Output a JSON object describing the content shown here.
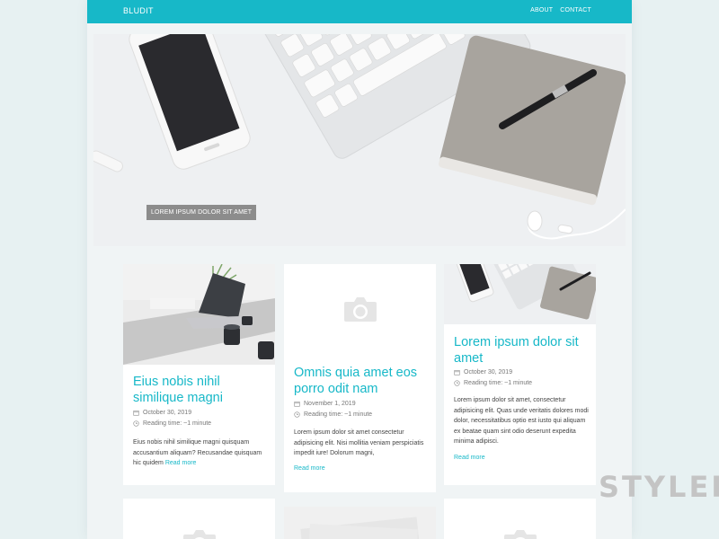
{
  "header": {
    "brand": "BLUDIT",
    "nav": [
      {
        "label": "ABOUT"
      },
      {
        "label": "CONTACT"
      }
    ]
  },
  "hero": {
    "caption": "LOREM IPSUM DOLOR SIT AMET"
  },
  "posts": [
    {
      "title": "Eius nobis nihil similique magni",
      "date": "October 30, 2019",
      "reading": "Reading time: ~1 minute",
      "excerpt": "Eius nobis nihil similique magni quisquam accusantium aliquam? Recusandae quisquam hic quidem",
      "read_more": "Read more"
    },
    {
      "title": "Omnis quia amet eos porro odit nam",
      "date": "November 1, 2019",
      "reading": "Reading time: ~1 minute",
      "excerpt": "Lorem ipsum dolor sit amet consectetur adipisicing elit. Nisi mollitia veniam perspiciatis impedit iure! Dolorum magni,",
      "read_more": "Read more"
    },
    {
      "title": "Lorem ipsum dolor sit amet",
      "date": "October 30, 2019",
      "reading": "Reading time: ~1 minute",
      "excerpt": "Lorem ipsum dolor sit amet, consectetur adipisicing elit. Quas unde veritatis dolores modi dolor, necessitatibus optio est iusto qui aliquam ex beatae quam sint odio deserunt expedita minima adipisci.",
      "read_more": "Read more"
    }
  ],
  "watermark": "STYLER",
  "colors": {
    "accent": "#17b8c8",
    "background": "#f0f4f5"
  }
}
